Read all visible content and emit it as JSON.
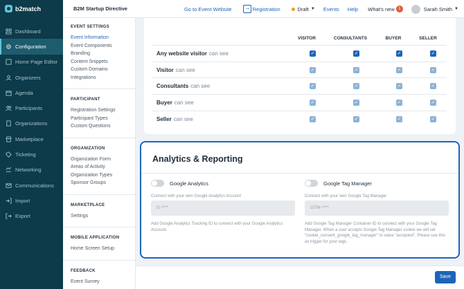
{
  "brand": {
    "logo_text": "b2match"
  },
  "header": {
    "event_name": "B2M Startup Directive",
    "go_to_event": "Go to Event Website",
    "registration": "Registration",
    "status": "Draft",
    "events": "Events",
    "help": "Help",
    "whats_new": "What's new",
    "whats_new_count": "1",
    "user_name": "Sarah Smith"
  },
  "nav": {
    "items": [
      {
        "label": "Dashboard",
        "icon": "dashboard-icon"
      },
      {
        "label": "Configuration",
        "icon": "gear-icon"
      },
      {
        "label": "Home Page Editor",
        "icon": "edit-icon"
      },
      {
        "label": "Organizers",
        "icon": "organizers-icon"
      },
      {
        "label": "Agenda",
        "icon": "agenda-icon"
      },
      {
        "label": "Participants",
        "icon": "participants-icon"
      },
      {
        "label": "Organizations",
        "icon": "organizations-icon"
      },
      {
        "label": "Marketplace",
        "icon": "marketplace-icon"
      },
      {
        "label": "Ticketing",
        "icon": "ticket-icon"
      },
      {
        "label": "Networking",
        "icon": "networking-icon"
      },
      {
        "label": "Communications",
        "icon": "communications-icon"
      },
      {
        "label": "Import",
        "icon": "import-icon"
      },
      {
        "label": "Export",
        "icon": "export-icon"
      }
    ]
  },
  "settings": {
    "event_settings": {
      "title": "EVENT SETTINGS",
      "items": [
        "Event Information",
        "Event Components",
        "Branding",
        "Content Snippets",
        "Custom Domains",
        "Integrations"
      ]
    },
    "participant": {
      "title": "PARTICIPANT",
      "items": [
        "Registration Settings",
        "Participant Types",
        "Custom Questions"
      ]
    },
    "organization": {
      "title": "ORGANIZATION",
      "items": [
        "Organization Form",
        "Areas of Activity",
        "Organization Types",
        "Sponsor Groups"
      ]
    },
    "marketplace": {
      "title": "MARKETPLACE",
      "items": [
        "Settings"
      ]
    },
    "mobile": {
      "title": "MOBILE APPLICATION",
      "items": [
        "Home Screen Setup"
      ]
    },
    "feedback": {
      "title": "FEEDBACK",
      "items": [
        "Event Survey"
      ]
    }
  },
  "permissions": {
    "columns": [
      "VISITOR",
      "CONSULTANTS",
      "BUYER",
      "SELLER"
    ],
    "rows": [
      {
        "label": "Any website visitor",
        "suffix": "can see"
      },
      {
        "label": "Visitor",
        "suffix": "can see"
      },
      {
        "label": "Consultants",
        "suffix": "can see"
      },
      {
        "label": "Buyer",
        "suffix": "can see"
      },
      {
        "label": "Seller",
        "suffix": "can see"
      }
    ]
  },
  "analytics": {
    "title": "Analytics & Reporting",
    "google_analytics": {
      "toggle_label": "Google Analytics",
      "field_label": "Connect with your own Google Analytics Account",
      "placeholder": "G-****",
      "help": "Add Google Analytics Tracking ID to connect with your Google Analytics Account."
    },
    "google_tag_manager": {
      "toggle_label": "Google Tag Manager",
      "field_label": "Connect with your own Google Tag Manager",
      "placeholder": "GTM-****",
      "help": "Add Google Tag Manager Container ID to connect with your Google Tag Manager. When a user accepts Google Tag Manager cookie we will set \"cookie_consent_google_tag_manager\" to value \"accepted\". Please use this as trigger for your tags."
    }
  },
  "footer": {
    "save_label": "Save"
  }
}
